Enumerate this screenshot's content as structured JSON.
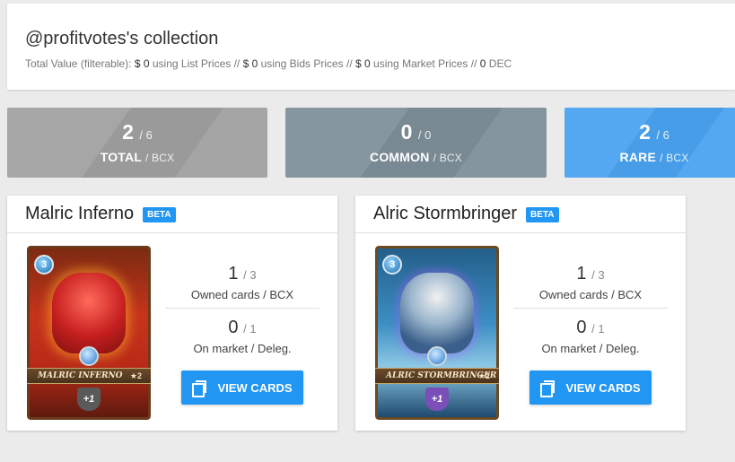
{
  "header": {
    "title": "@profitvotes's collection",
    "totals": {
      "prefix": "Total Value (filterable):",
      "list_value": "$ 0",
      "list_label": "using List Prices //",
      "bids_value": "$ 0",
      "bids_label": "using Bids Prices //",
      "market_value": "$ 0",
      "market_label": "using Market Prices //",
      "dec_value": "0",
      "dec_label": "DEC"
    }
  },
  "stats": [
    {
      "count": "2",
      "of": "/ 6",
      "label": "TOTAL",
      "unit": "/ BCX",
      "color": "#a0a0a0"
    },
    {
      "count": "0",
      "of": "/ 0",
      "label": "COMMON",
      "unit": "/ BCX",
      "color": "#7e8f99"
    },
    {
      "count": "2",
      "of": "/ 6",
      "label": "RARE",
      "unit": "/ BCX",
      "color": "#4aa3f0"
    }
  ],
  "cards": [
    {
      "name": "Malric Inferno",
      "badge": "BETA",
      "art_name": "MALRIC INFERNO",
      "art_level": "★2",
      "art_mana": "3",
      "art_bonus": "+1",
      "owned": "1",
      "owned_of": "/ 3",
      "owned_caption": "Owned cards / BCX",
      "market": "0",
      "market_of": "/ 1",
      "market_caption": "On market / Deleg.",
      "button": "VIEW CARDS",
      "element": "fire"
    },
    {
      "name": "Alric Stormbringer",
      "badge": "BETA",
      "art_name": "ALRIC STORMBRINGER",
      "art_level": "★2",
      "art_mana": "3",
      "art_bonus": "+1",
      "owned": "1",
      "owned_of": "/ 3",
      "owned_caption": "Owned cards / BCX",
      "market": "0",
      "market_of": "/ 1",
      "market_caption": "On market / Deleg.",
      "button": "VIEW CARDS",
      "element": "water"
    }
  ],
  "colors": {
    "accent": "#2196f3",
    "background": "#ebebeb"
  },
  "icons": {
    "view_cards": "cards-icon"
  }
}
